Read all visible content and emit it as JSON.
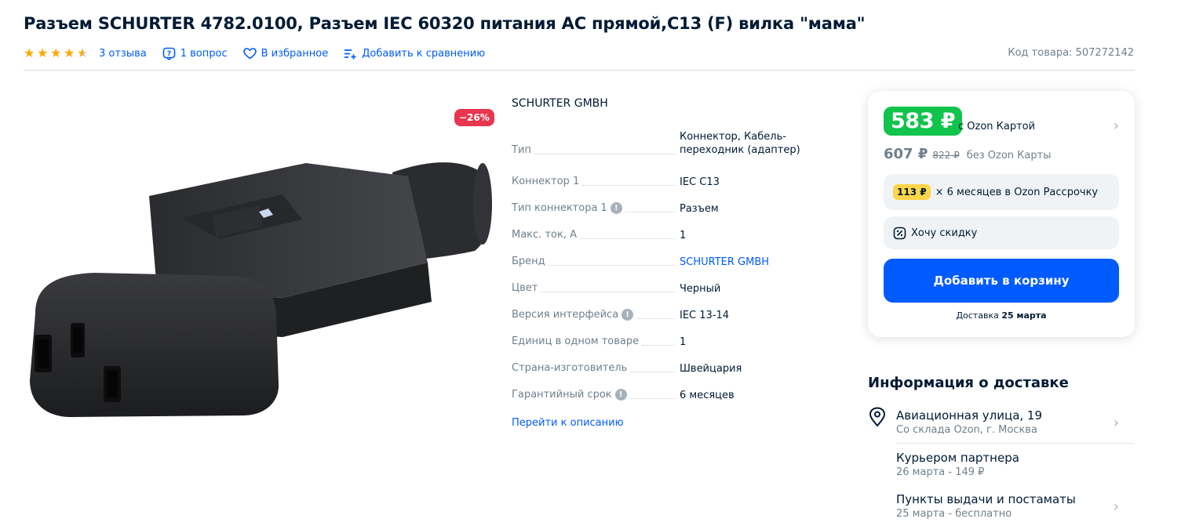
{
  "product": {
    "title": "Разъем SCHURTER 4782.0100, Разъем IEC 60320 питания AC прямой,C13 (F) вилка \"мама\"",
    "rating": 4.5,
    "reviews_label": "3 отзыва",
    "questions_label": "1 вопрос",
    "favorites_label": "В избранное",
    "compare_label": "Добавить к сравнению",
    "sku_label": "Код товара: 507272142",
    "discount_badge": "−26%",
    "brand": "SCHURTER GMBH",
    "goto_description": "Перейти к описанию"
  },
  "specs": [
    {
      "key": "Тип",
      "value": "Коннектор, Кабель-переходник (адаптер)",
      "hint": false,
      "link": false
    },
    {
      "key": "Коннектор 1",
      "value": "IEC C13",
      "hint": false,
      "link": false
    },
    {
      "key": "Тип коннектора 1",
      "value": "Разъем",
      "hint": true,
      "link": false
    },
    {
      "key": "Макс. ток, А",
      "value": "1",
      "hint": false,
      "link": false
    },
    {
      "key": "Бренд",
      "value": "SCHURTER GMBH",
      "hint": false,
      "link": true
    },
    {
      "key": "Цвет",
      "value": "Черный",
      "hint": false,
      "link": false
    },
    {
      "key": "Версия интерфейса",
      "value": "IEC 13-14",
      "hint": true,
      "link": false
    },
    {
      "key": "Единиц в одном товаре",
      "value": "1",
      "hint": false,
      "link": false
    },
    {
      "key": "Страна-изготовитель",
      "value": "Швейцария",
      "hint": false,
      "link": false
    },
    {
      "key": "Гарантийный срок",
      "value": "6 месяцев",
      "hint": true,
      "link": false
    }
  ],
  "price_card": {
    "ozon_price": "583 ₽",
    "ozon_card_label": "с Ozon Картой",
    "regular_price": "607 ₽",
    "old_price": "822 ₽",
    "no_card_label": "без Ozon Карты",
    "installment_badge": "113 ₽",
    "installment_text": "× 6 месяцев в Ozon Рассрочку",
    "want_discount": "Хочу скидку",
    "add_to_cart": "Добавить в корзину",
    "delivery_prefix": "Доставка",
    "delivery_date": "25 марта"
  },
  "delivery_info": {
    "title": "Информация о доставке",
    "address": "Авиационная улица, 19",
    "address_sub": "Со склада Ozon, г. Москва",
    "courier": "Курьером партнера",
    "courier_sub": "26 марта - 149 ₽",
    "pickup": "Пункты выдачи и постаматы",
    "pickup_sub": "25 марта - бесплатно"
  },
  "colors": {
    "accent": "#005bff",
    "ozon_green": "#10c44c",
    "discount": "#e8364f",
    "star": "#ffa800"
  }
}
